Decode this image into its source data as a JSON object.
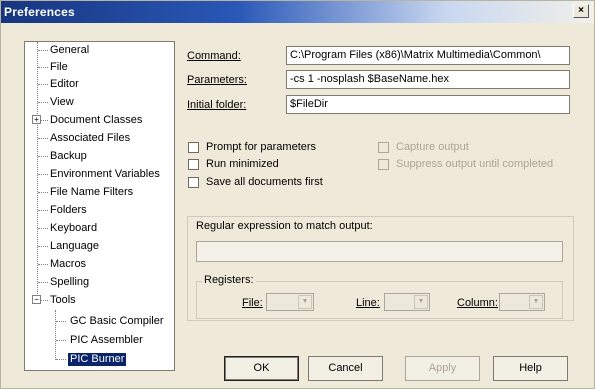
{
  "window": {
    "title": "Preferences",
    "close_glyph": "×"
  },
  "tree": {
    "items": [
      {
        "label": "General"
      },
      {
        "label": "File"
      },
      {
        "label": "Editor"
      },
      {
        "label": "View"
      },
      {
        "label": "Document Classes",
        "expander": "+"
      },
      {
        "label": "Associated Files"
      },
      {
        "label": "Backup"
      },
      {
        "label": "Environment Variables"
      },
      {
        "label": "File Name Filters"
      },
      {
        "label": "Folders"
      },
      {
        "label": "Keyboard"
      },
      {
        "label": "Language"
      },
      {
        "label": "Macros"
      },
      {
        "label": "Spelling"
      },
      {
        "label": "Tools",
        "expander": "−"
      },
      {
        "label": "GC Basic Compiler"
      },
      {
        "label": "PIC Assembler"
      },
      {
        "label": "PIC Burner",
        "selected": true
      }
    ]
  },
  "fields": {
    "command": {
      "label": "Command:",
      "value": "C:\\Program Files (x86)\\Matrix Multimedia\\Common\\"
    },
    "parameters": {
      "label": "Parameters:",
      "value": "-cs 1 -nosplash $BaseName.hex"
    },
    "initial_folder": {
      "label": "Initial folder:",
      "value": "$FileDir"
    }
  },
  "options": {
    "prompt": {
      "label": "Prompt for parameters",
      "checked": false
    },
    "minimized": {
      "label": "Run minimized",
      "checked": false
    },
    "save_all": {
      "label": "Save all documents first",
      "checked": false
    },
    "capture": {
      "label": "Capture output",
      "checked": false,
      "disabled": true
    },
    "suppress": {
      "label": "Suppress output until completed",
      "checked": false,
      "disabled": true
    }
  },
  "regex": {
    "title": "Regular expression to match output:",
    "value": ""
  },
  "registers": {
    "title": "Registers:",
    "file_label": "File:",
    "line_label": "Line:",
    "column_label": "Column:",
    "arrow_glyph": "▼"
  },
  "buttons": {
    "ok": "OK",
    "cancel": "Cancel",
    "apply": "Apply",
    "help": "Help"
  }
}
